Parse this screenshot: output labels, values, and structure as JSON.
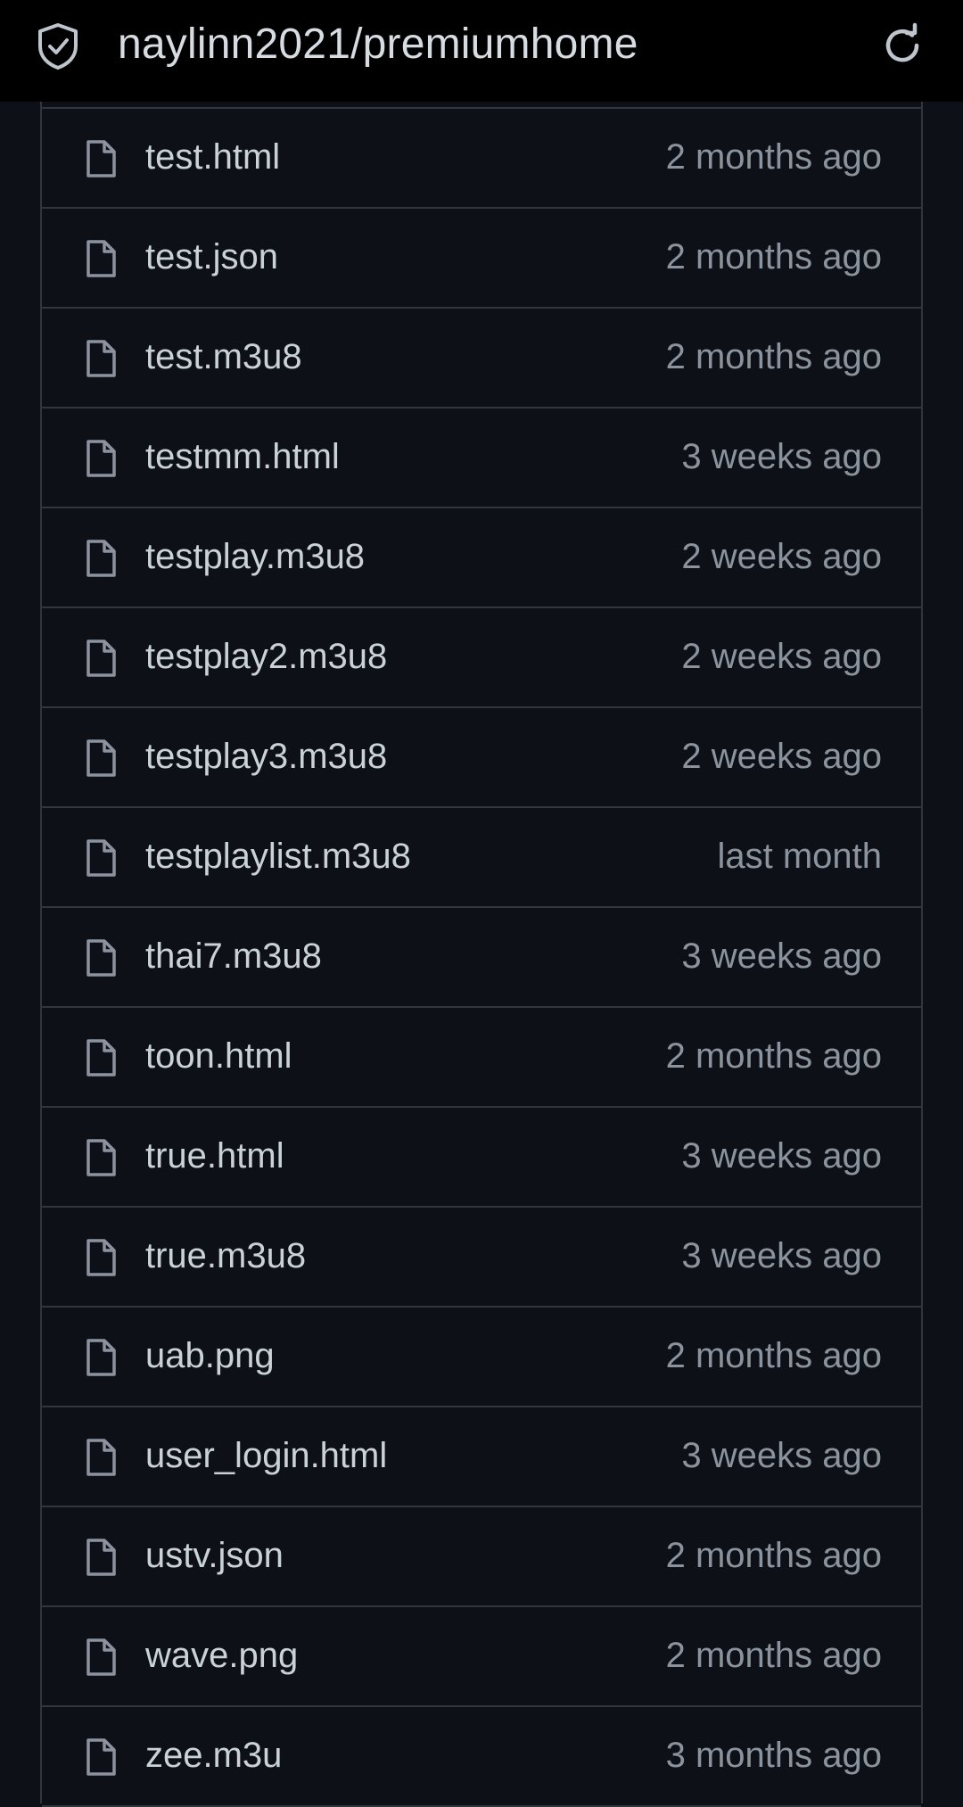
{
  "topbar": {
    "title": "naylinn2021/premiumhome",
    "left_icon": "shield-check-icon",
    "right_icon": "reload-icon"
  },
  "files": [
    {
      "name": "test.html",
      "age": "2 months ago",
      "icon": "file-icon"
    },
    {
      "name": "test.json",
      "age": "2 months ago",
      "icon": "file-icon"
    },
    {
      "name": "test.m3u8",
      "age": "2 months ago",
      "icon": "file-icon"
    },
    {
      "name": "testmm.html",
      "age": "3 weeks ago",
      "icon": "file-icon"
    },
    {
      "name": "testplay.m3u8",
      "age": "2 weeks ago",
      "icon": "file-icon"
    },
    {
      "name": "testplay2.m3u8",
      "age": "2 weeks ago",
      "icon": "file-icon"
    },
    {
      "name": "testplay3.m3u8",
      "age": "2 weeks ago",
      "icon": "file-icon"
    },
    {
      "name": "testplaylist.m3u8",
      "age": "last month",
      "icon": "file-icon"
    },
    {
      "name": "thai7.m3u8",
      "age": "3 weeks ago",
      "icon": "file-icon"
    },
    {
      "name": "toon.html",
      "age": "2 months ago",
      "icon": "file-icon"
    },
    {
      "name": "true.html",
      "age": "3 weeks ago",
      "icon": "file-icon"
    },
    {
      "name": "true.m3u8",
      "age": "3 weeks ago",
      "icon": "file-icon"
    },
    {
      "name": "uab.png",
      "age": "2 months ago",
      "icon": "file-icon"
    },
    {
      "name": "user_login.html",
      "age": "3 weeks ago",
      "icon": "file-icon"
    },
    {
      "name": "ustv.json",
      "age": "2 months ago",
      "icon": "file-icon"
    },
    {
      "name": "wave.png",
      "age": "2 months ago",
      "icon": "file-icon"
    },
    {
      "name": "zee.m3u",
      "age": "3 months ago",
      "icon": "file-icon"
    }
  ],
  "colors": {
    "background": "#0d1117",
    "topbar": "#000000",
    "border": "#30363d",
    "name_text": "#c9d1d9",
    "age_text": "#8b949e"
  }
}
